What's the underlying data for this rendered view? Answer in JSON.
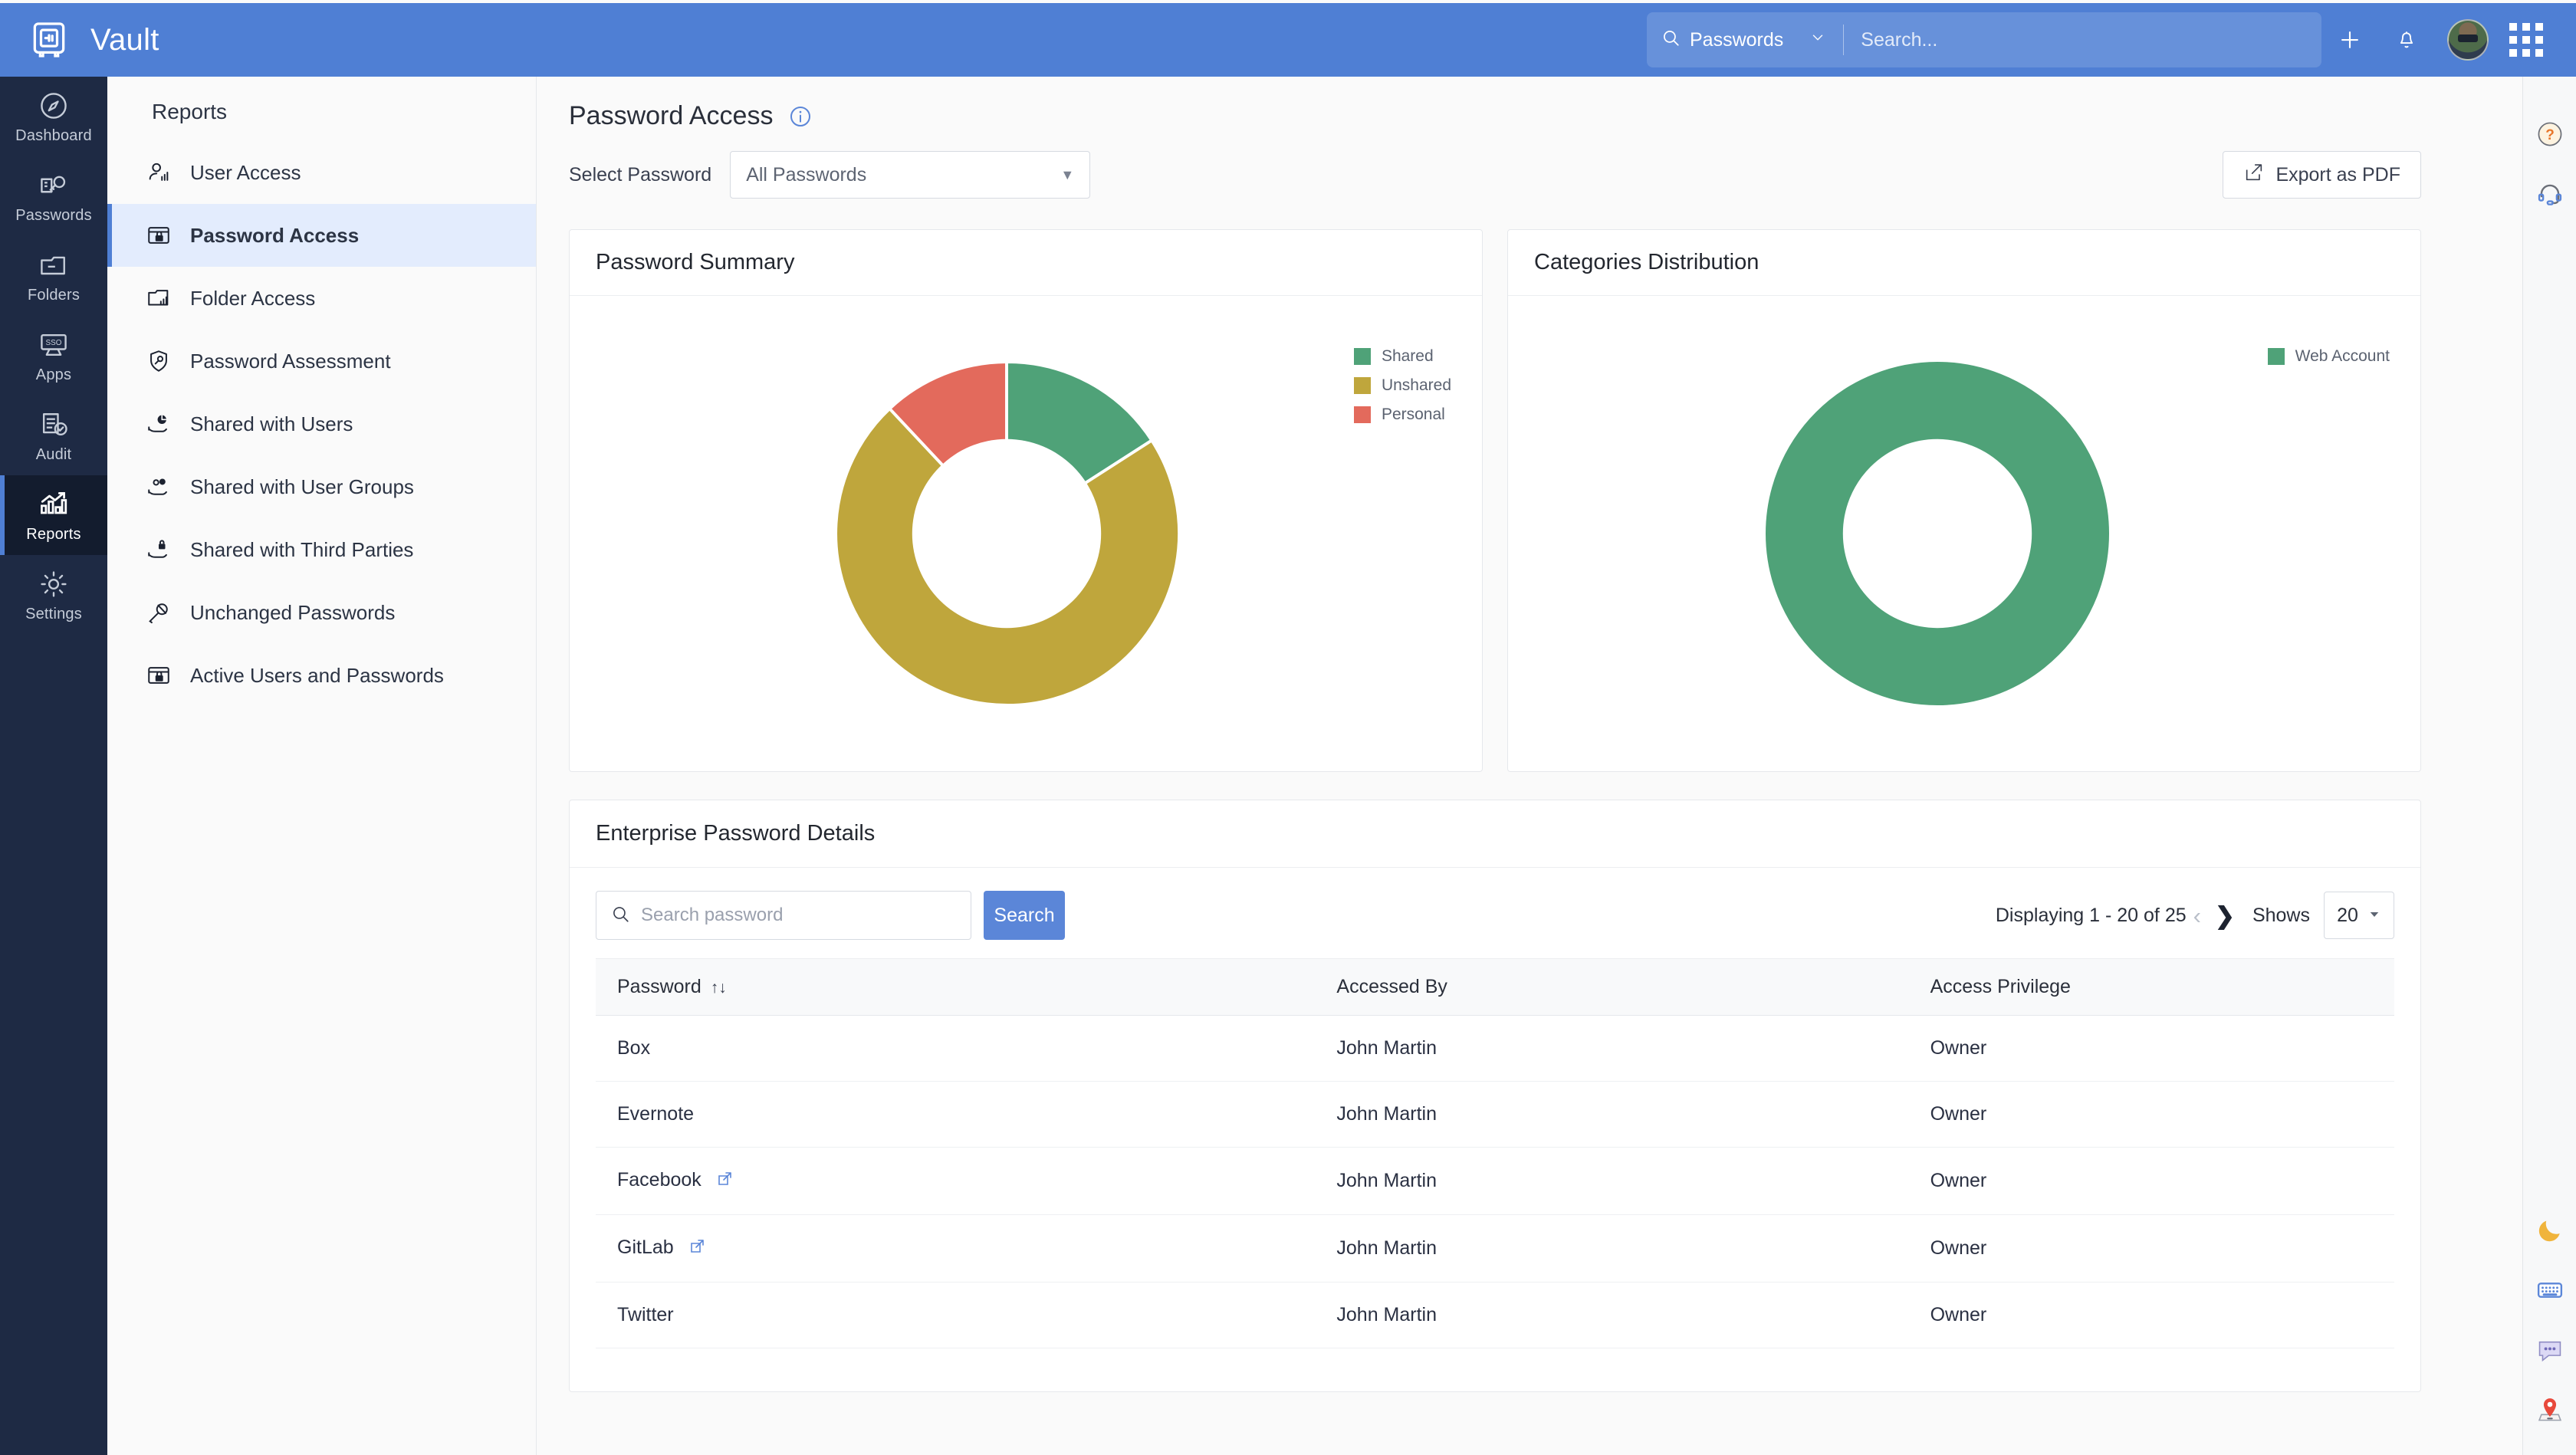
{
  "topbar": {
    "brand_name": "Vault",
    "brand_icon": "vault-logo-icon",
    "search_category": "Passwords",
    "search_placeholder": "Search...",
    "add_icon": "plus-icon",
    "bell_icon": "bell-icon",
    "avatar_icon": "user-avatar",
    "apps_icon": "grid-apps-icon",
    "accent_color": "#4f7fd4"
  },
  "leftnav": {
    "items": [
      {
        "label": "Dashboard",
        "icon": "compass-icon",
        "active": false
      },
      {
        "label": "Passwords",
        "icon": "key-document-icon",
        "active": false
      },
      {
        "label": "Folders",
        "icon": "folder-icon",
        "active": false
      },
      {
        "label": "Apps",
        "icon": "sso-monitor-icon",
        "active": false
      },
      {
        "label": "Audit",
        "icon": "clipboard-check-icon",
        "active": false
      },
      {
        "label": "Reports",
        "icon": "bar-chart-icon",
        "active": true
      },
      {
        "label": "Settings",
        "icon": "gear-icon",
        "active": false
      }
    ]
  },
  "reports_panel": {
    "title": "Reports",
    "items": [
      {
        "label": "User Access",
        "icon": "user-access-icon",
        "active": false
      },
      {
        "label": "Password Access",
        "icon": "password-access-icon",
        "active": true
      },
      {
        "label": "Folder Access",
        "icon": "folder-access-icon",
        "active": false
      },
      {
        "label": "Password Assessment",
        "icon": "shield-key-icon",
        "active": false
      },
      {
        "label": "Shared with Users",
        "icon": "share-user-icon",
        "active": false
      },
      {
        "label": "Shared with User Groups",
        "icon": "share-group-icon",
        "active": false
      },
      {
        "label": "Shared with Third Parties",
        "icon": "share-lock-icon",
        "active": false
      },
      {
        "label": "Unchanged Passwords",
        "icon": "key-block-icon",
        "active": false
      },
      {
        "label": "Active Users and Passwords",
        "icon": "password-access-icon",
        "active": false
      }
    ]
  },
  "page": {
    "title": "Password Access",
    "info_icon": "info-icon",
    "select_label": "Select Password",
    "select_value": "All Passwords",
    "export_label": "Export as PDF",
    "export_icon": "export-icon"
  },
  "chart_data": [
    {
      "type": "pie",
      "title": "Password Summary",
      "categories": [
        "Shared",
        "Unshared",
        "Personal"
      ],
      "values": [
        16,
        72,
        12
      ],
      "colors": [
        "#4fa278",
        "#bfa63c",
        "#e36a5c"
      ],
      "legend_position": "right",
      "donut": true
    },
    {
      "type": "pie",
      "title": "Categories Distribution",
      "categories": [
        "Web Account"
      ],
      "values": [
        100
      ],
      "colors": [
        "#4fa278"
      ],
      "legend_position": "right",
      "donut": true
    }
  ],
  "table_card": {
    "title": "Enterprise Password Details",
    "search_placeholder": "Search password",
    "search_value": "",
    "search_icon": "search-icon",
    "search_button": "Search",
    "pagination": {
      "display_text": "Displaying 1 - 20 of 25",
      "prev_icon": "chevron-left-icon",
      "next_icon": "chevron-right-icon",
      "shows_label": "Shows",
      "shows_value": "20"
    },
    "columns": [
      "Password",
      "Accessed By",
      "Access Privilege"
    ],
    "sort_icon": "sort-updown-icon",
    "rows": [
      {
        "password": "Box",
        "external": false,
        "accessed_by": "John Martin",
        "privilege": "Owner"
      },
      {
        "password": "Evernote",
        "external": false,
        "accessed_by": "John Martin",
        "privilege": "Owner"
      },
      {
        "password": "Facebook",
        "external": true,
        "accessed_by": "John Martin",
        "privilege": "Owner"
      },
      {
        "password": "GitLab",
        "external": true,
        "accessed_by": "John Martin",
        "privilege": "Owner"
      },
      {
        "password": "Twitter",
        "external": false,
        "accessed_by": "John Martin",
        "privilege": "Owner"
      }
    ]
  },
  "rightrail": {
    "top_icons": [
      "help-question-icon",
      "headset-support-icon"
    ],
    "bottom_icons": [
      "moon-darkmode-icon",
      "keyboard-icon",
      "chat-bubble-icon",
      "map-pin-icon"
    ]
  }
}
